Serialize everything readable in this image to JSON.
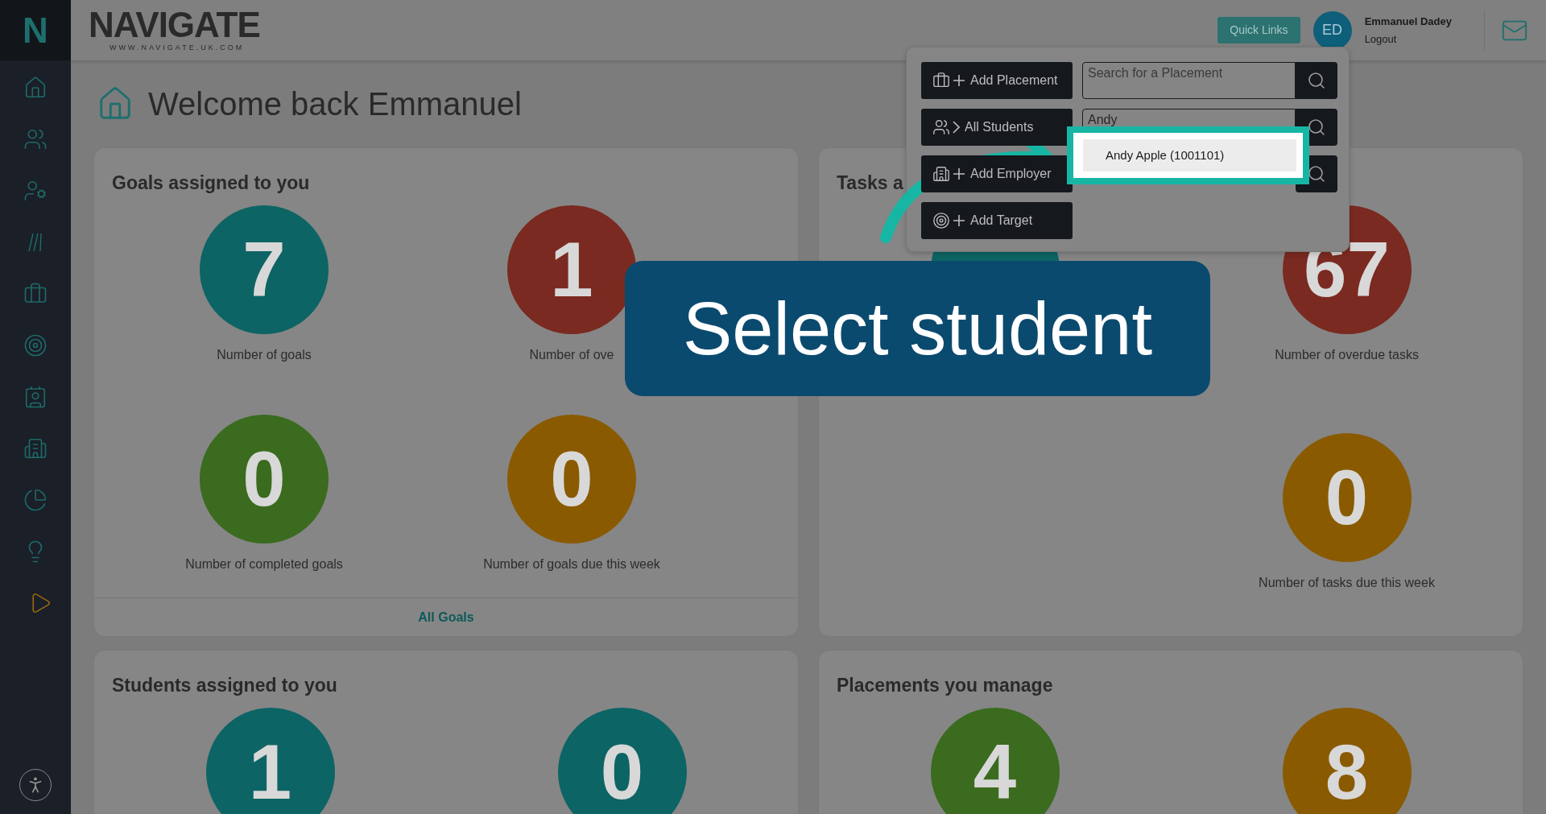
{
  "sidebar": {
    "logo": "N",
    "items": [
      {
        "kind": "home"
      },
      {
        "kind": "users"
      },
      {
        "kind": "user-gear"
      },
      {
        "kind": "slashes"
      },
      {
        "kind": "briefcase"
      },
      {
        "kind": "target"
      },
      {
        "kind": "contact"
      },
      {
        "kind": "building"
      },
      {
        "kind": "pie"
      },
      {
        "kind": "bulb"
      },
      {
        "kind": "play"
      }
    ]
  },
  "header": {
    "logo": "NAVIGATE",
    "logo_url": "WWW.NAVIGATE.UK.COM",
    "quick_links": "Quick Links",
    "user": {
      "initials": "ED",
      "name": "Emmanuel Dadey",
      "logout": "Logout"
    }
  },
  "page": {
    "title": "Welcome back Emmanuel"
  },
  "cards": [
    {
      "title": "Goals assigned to you",
      "stats": [
        {
          "kind": "stat",
          "value": "7",
          "label": "Number of goals",
          "color": "#0d6464"
        },
        {
          "kind": "stat",
          "value": "1",
          "label": "Number of ove",
          "color": "#7a2a20"
        },
        {
          "kind": "stat",
          "value": "0",
          "label": "Number of completed goals",
          "color": "#3a6b1e"
        },
        {
          "kind": "stat",
          "value": "0",
          "label": "Number of goals due this week",
          "color": "#8a5a00"
        }
      ],
      "footer": "All Goals"
    },
    {
      "title": "Tasks a",
      "stats": [
        {
          "kind": "stat",
          "color": "#0d6464"
        },
        {
          "kind": "stat",
          "value": "67",
          "label": "Number of overdue tasks",
          "color": "#7a2a20"
        },
        {
          "kind": "blank"
        },
        {
          "kind": "stat",
          "value": "0",
          "label": "Number of tasks due this week",
          "color": "#8a5a00"
        }
      ]
    },
    {
      "title": "Students assigned to you",
      "stats": [
        {
          "kind": "stat",
          "value": "1",
          "color": "#0d6464"
        },
        {
          "kind": "stat",
          "value": "0",
          "color": "#0d6464"
        }
      ]
    },
    {
      "title": "Placements you manage",
      "stats": [
        {
          "kind": "stat",
          "value": "4",
          "color": "#3a6b1e"
        },
        {
          "kind": "stat",
          "value": "8",
          "color": "#8a5a00"
        }
      ]
    }
  ],
  "quick_links_panel": {
    "actions": [
      {
        "kind": "placement",
        "label": "Add Placement"
      },
      {
        "kind": "students",
        "label": "All Students"
      },
      {
        "kind": "employer",
        "label": "Add Employer"
      },
      {
        "kind": "target",
        "label": "Add Target"
      }
    ],
    "searches": [
      {
        "kind": "field",
        "placeholder": "Search for a Placement"
      },
      {
        "kind": "field",
        "value": "Andy"
      },
      {
        "kind": "button"
      }
    ],
    "suggestions": [
      {
        "label": "Andy Apple (1001101)",
        "selected": true
      }
    ]
  },
  "tutorial": {
    "callout": "Select student"
  }
}
